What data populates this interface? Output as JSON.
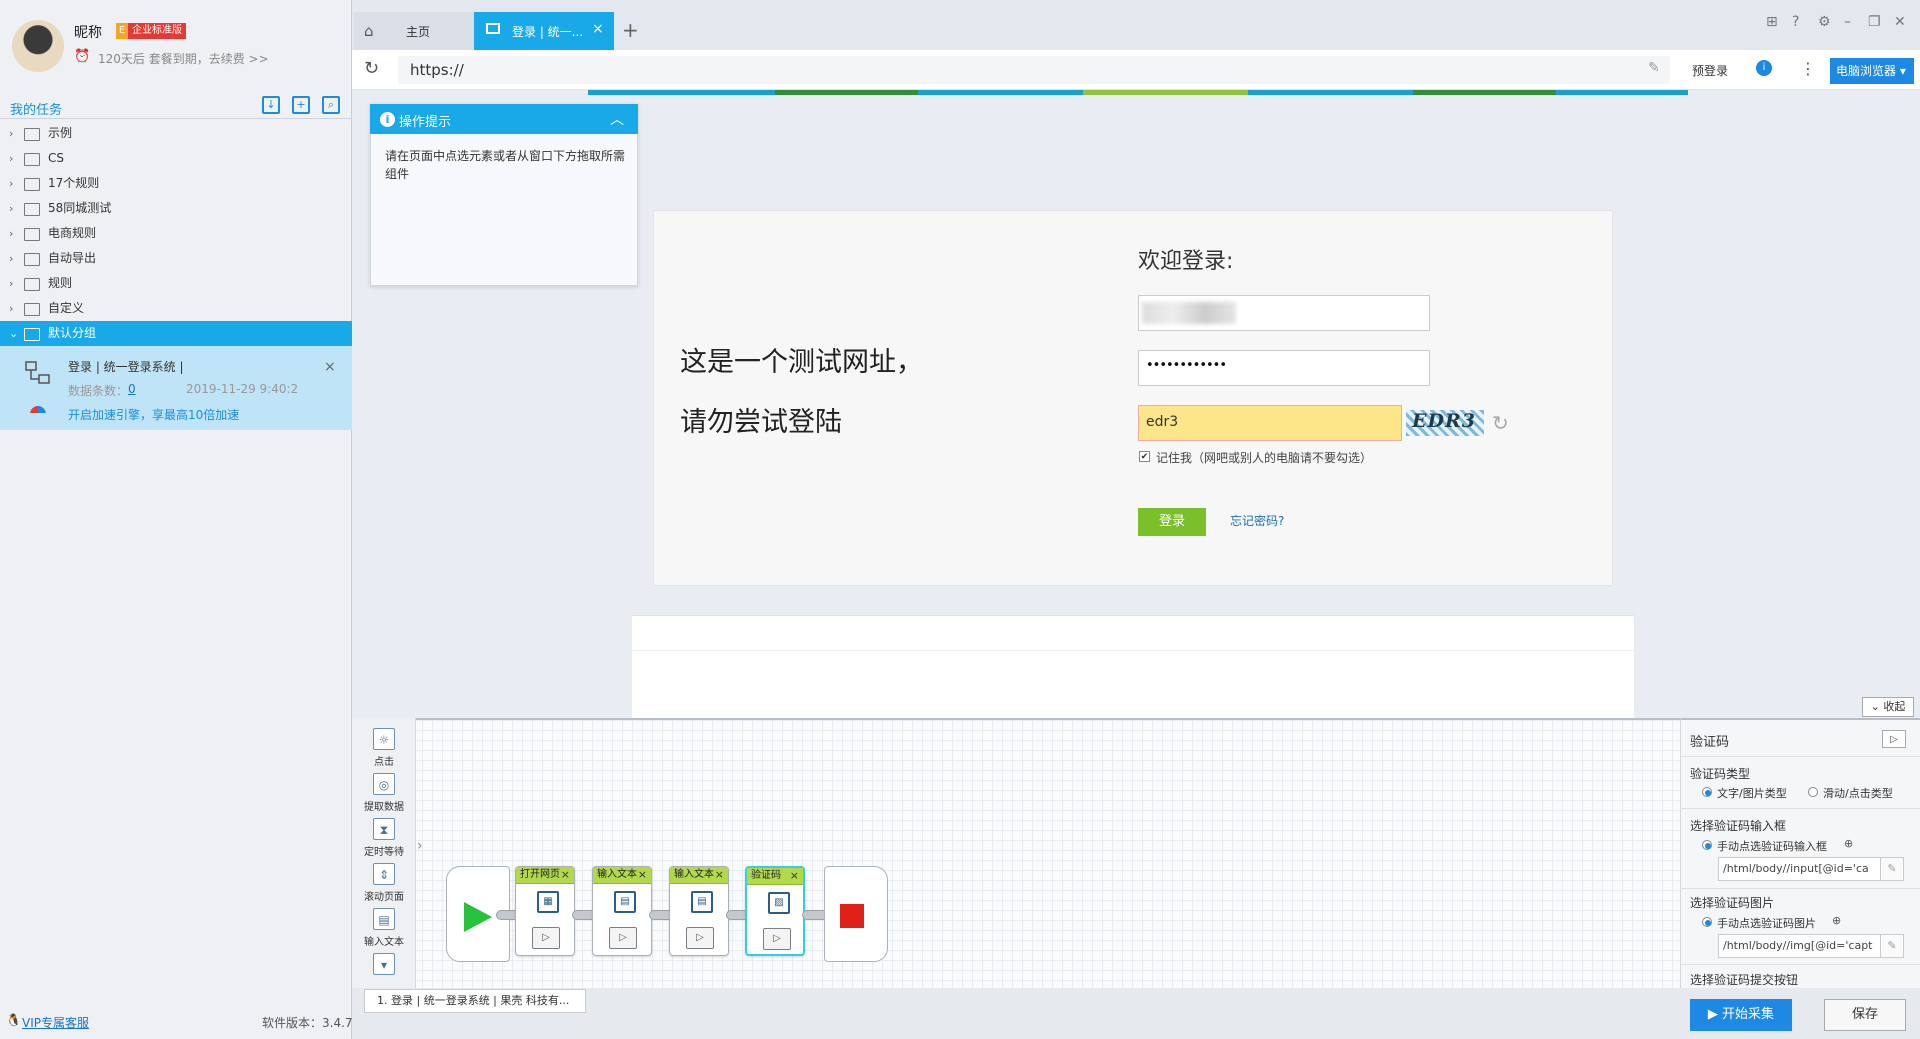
{
  "user": {
    "nickname": "昵称",
    "badge_e": "E",
    "badge": "企业标准版",
    "expire_text": "120天后 套餐到期，去续费 >>"
  },
  "tasks": {
    "title": "我的任务",
    "items": [
      {
        "label": "示例"
      },
      {
        "label": "CS"
      },
      {
        "label": "17个规则"
      },
      {
        "label": "58同城测试"
      },
      {
        "label": "电商规则"
      },
      {
        "label": "自动导出"
      },
      {
        "label": "规则"
      },
      {
        "label": "自定义"
      },
      {
        "label": "默认分组"
      }
    ],
    "card": {
      "name": "登录 | 统一登录系统 |",
      "count_label": "数据条数：",
      "count": "0",
      "date": "2019-11-29 9:40:2",
      "speed_text": "开启加速引擎，享最高10倍加速"
    }
  },
  "footer_left": {
    "vip": "VIP专属客服",
    "version": "软件版本：3.4.7"
  },
  "tabs": {
    "home": "主页",
    "active": "登录 | 统一..."
  },
  "address": {
    "url": "https://",
    "prelogin": "预登录",
    "browser": "电脑浏览器 ▾"
  },
  "tip": {
    "title": "操作提示",
    "text": "请在页面中点选元素或者从窗口下方拖取所需组件"
  },
  "login_page": {
    "slogan1": "这是一个测试网址，",
    "slogan2": "请勿尝试登陆",
    "welcome": "欢迎登录:",
    "password": "••••••••••••",
    "captcha_value": "edr3",
    "captcha_image_text": "EDR3",
    "remember": "记住我（网吧或别人的电脑请不要勾选）",
    "login_button": "登录",
    "forget": "忘记密码?"
  },
  "palette": [
    {
      "label": "点击",
      "icon": "click-icon"
    },
    {
      "label": "提取数据",
      "icon": "extract-icon"
    },
    {
      "label": "定时等待",
      "icon": "hourglass-icon"
    },
    {
      "label": "滚动页面",
      "icon": "scroll-icon"
    },
    {
      "label": "输入文本",
      "icon": "textbox-icon"
    }
  ],
  "workflow": {
    "collapse": "收起",
    "nodes": [
      {
        "label": "打开网页",
        "icon": "webpage-icon"
      },
      {
        "label": "输入文本",
        "icon": "textbox-icon"
      },
      {
        "label": "输入文本",
        "icon": "textbox-icon"
      },
      {
        "label": "验证码",
        "icon": "image-icon"
      }
    ],
    "page_tab": "1. 登录 | 统一登录系统 | 果壳 科技有..."
  },
  "props": {
    "title": "验证码",
    "type_label": "验证码类型",
    "type_opt1": "文字/图片类型",
    "type_opt2": "滑动/点击类型",
    "input_label": "选择验证码输入框",
    "input_opt": "手动点选验证码输入框",
    "input_xpath": "/html/body//input[@id='ca",
    "image_label": "选择验证码图片",
    "image_opt": "手动点选验证码图片",
    "image_xpath": "/html/body//img[@id='capt",
    "submit_label": "选择验证码提交按钮"
  },
  "actions": {
    "start": "▶ 开始采集",
    "save": "保存"
  },
  "colors": {
    "accent": "#19a8e8",
    "primary_button": "#1e88e5",
    "login_button": "#7bbf2a",
    "captcha_field": "#fde58a",
    "badge": "#e53935"
  }
}
